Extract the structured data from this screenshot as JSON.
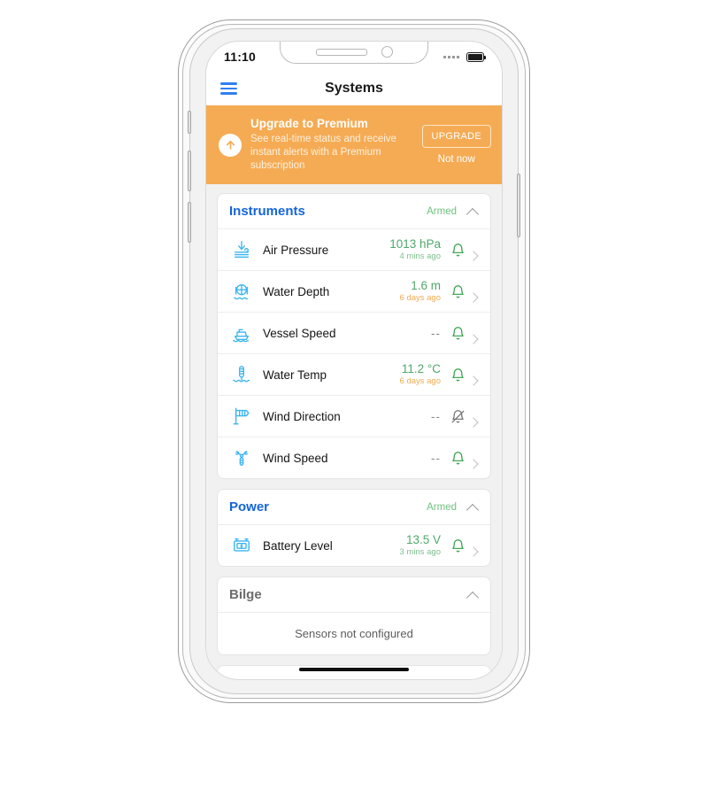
{
  "status_bar": {
    "time": "11:10",
    "signal_icon": "signal-dots-icon",
    "battery_icon": "battery-full-icon"
  },
  "navbar": {
    "menu_icon": "hamburger-menu-icon",
    "title": "Systems"
  },
  "banner": {
    "icon": "arrow-up-circle-icon",
    "title": "Upgrade to Premium",
    "subtitle": "See real-time status and receive instant alerts with a Premium subscription",
    "primary_label": "UPGRADE",
    "secondary_label": "Not now",
    "background_color": "#f5ab54"
  },
  "sections": [
    {
      "title": "Instruments",
      "status": "Armed",
      "collapse_icon": "chevron-up-icon",
      "rows": [
        {
          "icon": "air-pressure-icon",
          "label": "Air Pressure",
          "value": "1013 hPa",
          "timestamp": "4 mins ago",
          "timestamp_state": "fresh",
          "alert_icon": "bell-icon",
          "alert_enabled": true,
          "chevron_icon": "chevron-right-icon"
        },
        {
          "icon": "water-depth-icon",
          "label": "Water Depth",
          "value": "1.6 m",
          "timestamp": "6 days ago",
          "timestamp_state": "stale",
          "alert_icon": "bell-icon",
          "alert_enabled": true,
          "chevron_icon": "chevron-right-icon"
        },
        {
          "icon": "vessel-speed-icon",
          "label": "Vessel Speed",
          "value": "--",
          "timestamp": "",
          "timestamp_state": "none",
          "alert_icon": "bell-icon",
          "alert_enabled": true,
          "chevron_icon": "chevron-right-icon"
        },
        {
          "icon": "water-temp-icon",
          "label": "Water Temp",
          "value": "11.2 °C",
          "timestamp": "6 days ago",
          "timestamp_state": "stale",
          "alert_icon": "bell-icon",
          "alert_enabled": true,
          "chevron_icon": "chevron-right-icon"
        },
        {
          "icon": "wind-direction-icon",
          "label": "Wind Direction",
          "value": "--",
          "timestamp": "",
          "timestamp_state": "none",
          "alert_icon": "bell-off-icon",
          "alert_enabled": false,
          "chevron_icon": "chevron-right-icon"
        },
        {
          "icon": "wind-speed-icon",
          "label": "Wind Speed",
          "value": "--",
          "timestamp": "",
          "timestamp_state": "none",
          "alert_icon": "bell-icon",
          "alert_enabled": true,
          "chevron_icon": "chevron-right-icon"
        }
      ]
    },
    {
      "title": "Power",
      "status": "Armed",
      "collapse_icon": "chevron-up-icon",
      "rows": [
        {
          "icon": "battery-level-icon",
          "label": "Battery Level",
          "value": "13.5 V",
          "timestamp": "3 mins ago",
          "timestamp_state": "fresh",
          "alert_icon": "bell-icon",
          "alert_enabled": true,
          "chevron_icon": "chevron-right-icon"
        }
      ]
    },
    {
      "title": "Bilge",
      "status": "",
      "collapse_icon": "chevron-up-icon",
      "title_muted": true,
      "empty_message": "Sensors not configured",
      "rows": []
    }
  ],
  "colors": {
    "accent_blue": "#1565d8",
    "icon_blue": "#3cb5f0",
    "value_green": "#4fa86a",
    "bell_green": "#2f9e44",
    "banner_orange": "#f5ab54",
    "stale_orange": "#f0ab53"
  }
}
